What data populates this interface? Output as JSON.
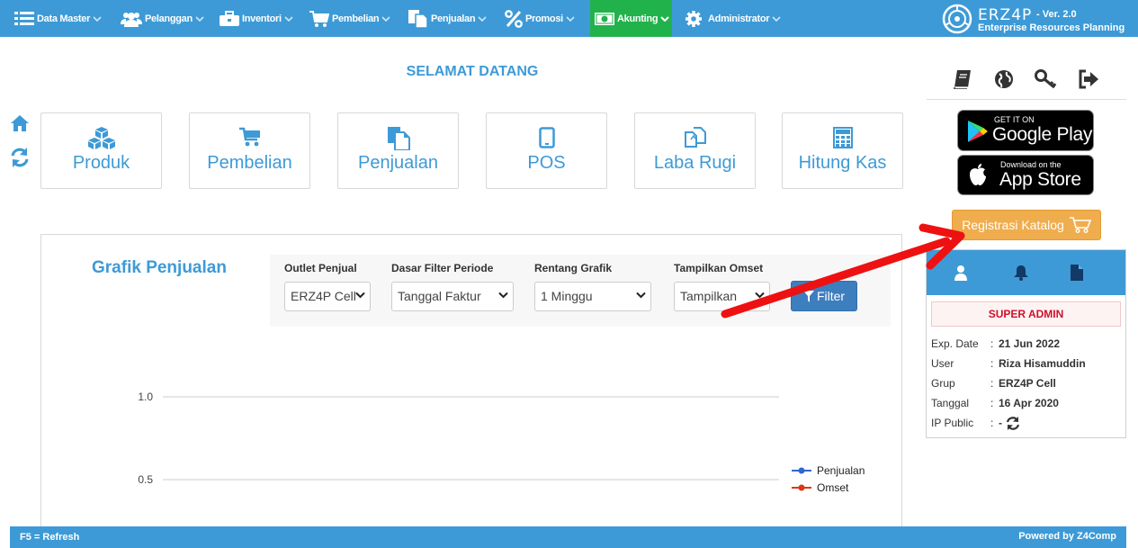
{
  "nav": {
    "items": [
      {
        "label": "Data Master",
        "icon": "list-icon"
      },
      {
        "label": "Pelanggan",
        "icon": "users-icon"
      },
      {
        "label": "Inventori",
        "icon": "briefcase-icon"
      },
      {
        "label": "Pembelian",
        "icon": "cart-icon"
      },
      {
        "label": "Penjualan",
        "icon": "copy-icon"
      },
      {
        "label": "Promosi",
        "icon": "percent-icon"
      },
      {
        "label": "Akunting",
        "icon": "money-icon",
        "active": true
      },
      {
        "label": "Administrator",
        "icon": "gear-icon"
      }
    ],
    "brand": {
      "name": "ERZ4P",
      "version": "- Ver. 2.0",
      "subtitle": "Enterprise Resources Planning"
    }
  },
  "welcome": "SELAMAT DATANG",
  "tiles": [
    {
      "label": "Produk",
      "icon": "cubes-icon"
    },
    {
      "label": "Pembelian",
      "icon": "cart-icon"
    },
    {
      "label": "Penjualan",
      "icon": "files-icon"
    },
    {
      "label": "POS",
      "icon": "tablet-icon"
    },
    {
      "label": "Laba Rugi",
      "icon": "clone-icon"
    },
    {
      "label": "Hitung Kas",
      "icon": "calculator-icon"
    }
  ],
  "chart_panel": {
    "title": "Grafik Penjualan",
    "filters": [
      {
        "label": "Outlet Penjual",
        "value": "ERZ4P Cell"
      },
      {
        "label": "Dasar Filter Periode",
        "value": "Tanggal Faktur"
      },
      {
        "label": "Rentang Grafik",
        "value": "1 Minggu"
      },
      {
        "label": "Tampilkan Omset",
        "value": "Tampilkan"
      }
    ],
    "filter_button": "Filter"
  },
  "chart_data": {
    "type": "line",
    "title": "",
    "xlabel": "",
    "ylabel": "",
    "y_ticks": [
      "1.0",
      "0.5"
    ],
    "ylim": [
      0.5,
      1.0
    ],
    "legend_position": "right",
    "series": [
      {
        "name": "Penjualan",
        "color": "#3366cc",
        "values": []
      },
      {
        "name": "Omset",
        "color": "#dc3912",
        "values": []
      }
    ]
  },
  "stores": {
    "google": {
      "small": "GET IT ON",
      "big": "Google Play"
    },
    "apple": {
      "small": "Download on the",
      "big": "App Store"
    }
  },
  "register_button": "Registrasi Katalog",
  "profile": {
    "role": "SUPER ADMIN",
    "rows": [
      {
        "key": "Exp. Date",
        "sep": ":",
        "value": "21 Jun 2022"
      },
      {
        "key": "User",
        "sep": ":",
        "value": "Riza Hisamuddin"
      },
      {
        "key": "Grup",
        "sep": ":",
        "value": "ERZ4P Cell"
      },
      {
        "key": "Tanggal",
        "sep": ":",
        "value": "16 Apr 2020"
      },
      {
        "key": "IP Public",
        "sep": ":",
        "value": "-"
      }
    ]
  },
  "footer": {
    "left": "F5 = Refresh",
    "right": "Powered by Z4Comp"
  },
  "colors": {
    "primary": "#3d9ad6",
    "active_nav": "#22b24c",
    "register": "#f0ad4e",
    "role_text": "#d0102a",
    "arrow": "#ee1111"
  }
}
